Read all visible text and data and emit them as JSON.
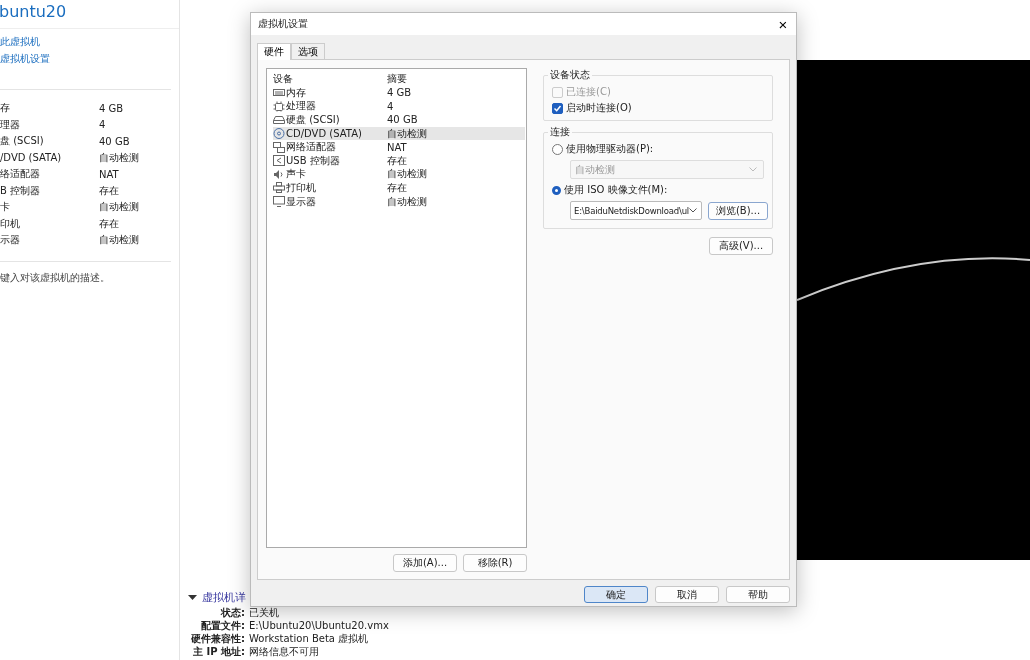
{
  "vm_summary": {
    "title": "buntu20",
    "links": [
      "此虚拟机",
      "虚拟机设置"
    ],
    "devices": [
      {
        "name": "存",
        "value": "4 GB"
      },
      {
        "name": "理器",
        "value": "4"
      },
      {
        "name": "盘 (SCSI)",
        "value": "40 GB"
      },
      {
        "name": "/DVD (SATA)",
        "value": "自动检测"
      },
      {
        "name": "络适配器",
        "value": "NAT"
      },
      {
        "name": "B 控制器",
        "value": "存在"
      },
      {
        "name": "卡",
        "value": "自动检测"
      },
      {
        "name": "印机",
        "value": "存在"
      },
      {
        "name": "示器",
        "value": "自动检测"
      }
    ],
    "description": "键入对该虚拟机的描述。"
  },
  "details": {
    "heading": "虚拟机详",
    "expanded": true,
    "rows": [
      {
        "label": "状态:",
        "value": "已关机"
      },
      {
        "label": "配置文件:",
        "value": "E:\\Ubuntu20\\Ubuntu20.vmx"
      },
      {
        "label": "硬件兼容性:",
        "value": "Workstation Beta 虚拟机"
      },
      {
        "label": "主 IP 地址:",
        "value": "网络信息不可用"
      }
    ]
  },
  "dialog": {
    "title": "虚拟机设置",
    "close": "×",
    "tabs": [
      {
        "label": "硬件",
        "selected": true
      },
      {
        "label": "选项",
        "selected": false
      }
    ],
    "device_list": {
      "columns": [
        "设备",
        "摘要"
      ],
      "rows": [
        {
          "kind": "memory",
          "name": "内存",
          "summary": "4 GB",
          "selected": false
        },
        {
          "kind": "cpu",
          "name": "处理器",
          "summary": "4",
          "selected": false
        },
        {
          "kind": "disk",
          "name": "硬盘 (SCSI)",
          "summary": "40 GB",
          "selected": false
        },
        {
          "kind": "cdrom",
          "name": "CD/DVD (SATA)",
          "summary": "自动检测",
          "selected": true
        },
        {
          "kind": "network",
          "name": "网络适配器",
          "summary": "NAT",
          "selected": false
        },
        {
          "kind": "usb",
          "name": "USB 控制器",
          "summary": "存在",
          "selected": false
        },
        {
          "kind": "sound",
          "name": "声卡",
          "summary": "自动检测",
          "selected": false
        },
        {
          "kind": "printer",
          "name": "打印机",
          "summary": "存在",
          "selected": false
        },
        {
          "kind": "display",
          "name": "显示器",
          "summary": "自动检测",
          "selected": false
        }
      ]
    },
    "list_buttons": [
      "添加(A)...",
      "移除(R)"
    ],
    "device_status": {
      "title": "设备状态",
      "options": [
        {
          "label": "已连接(C)",
          "checked": false,
          "disabled": true
        },
        {
          "label": "启动时连接(O)",
          "checked": true,
          "disabled": false
        }
      ]
    },
    "connection": {
      "title": "连接",
      "options": [
        {
          "label": "使用物理驱动器(P):",
          "selected": false
        },
        {
          "label": "使用 ISO 映像文件(M):",
          "selected": true
        }
      ],
      "drive": {
        "value": "自动检测",
        "disabled": true
      },
      "iso": {
        "value": "E:\\BaiduNetdiskDownload\\ul"
      },
      "browse_button": "浏览(B)...",
      "advanced_button": "高级(V)..."
    },
    "footer_buttons": [
      {
        "label": "确定",
        "default": true
      },
      {
        "label": "取消",
        "default": false
      },
      {
        "label": "帮助",
        "default": false
      }
    ]
  }
}
